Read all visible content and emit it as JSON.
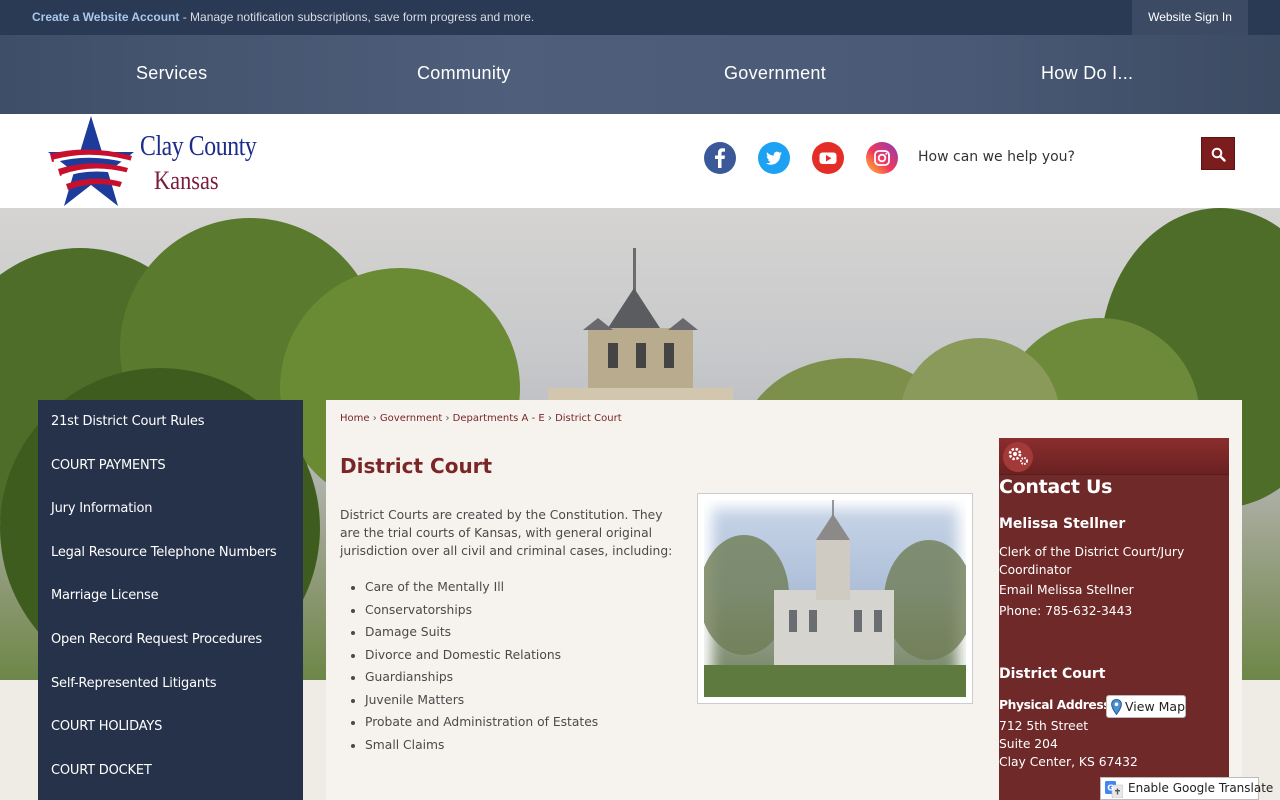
{
  "topbar": {
    "create_account_link": "Create a Website Account",
    "message": " - Manage notification subscriptions, save form progress and more.",
    "sign_in": "Website Sign In"
  },
  "main_nav": {
    "items": [
      "Services",
      "Community",
      "Government",
      "How Do I..."
    ]
  },
  "header": {
    "logo_line1": "Clay County",
    "logo_line2": "Kansas",
    "social_icons": [
      "facebook-icon",
      "twitter-icon",
      "youtube-icon",
      "instagram-icon"
    ],
    "search_placeholder": "How can we help you?",
    "search_icon": "search-icon"
  },
  "sidebar": {
    "items": [
      "21st District Court Rules",
      "COURT PAYMENTS",
      "Jury Information",
      "Legal Resource Telephone Numbers",
      "Marriage License",
      "Open Record Request Procedures",
      "Self-Represented Litigants",
      "COURT HOLIDAYS",
      "COURT DOCKET"
    ]
  },
  "breadcrumb": {
    "items": [
      "Home",
      "Government",
      "Departments A - E",
      "District Court"
    ],
    "separator": "›"
  },
  "main": {
    "title": "District Court",
    "intro": "District Courts are created by the Constitution. They are the trial courts of Kansas, with general original jurisdiction over all civil and criminal cases, including:",
    "cases": [
      "Care of the Mentally Ill",
      "Conservatorships",
      "Damage Suits",
      "Divorce and Domestic Relations",
      "Guardianships",
      "Juvenile Matters",
      "Probate and Administration of Estates",
      "Small Claims"
    ]
  },
  "contact": {
    "title": "Contact Us",
    "name": "Melissa Stellner",
    "role": "Clerk of the District Court/Jury Coordinator",
    "email": "Email Melissa Stellner",
    "phone": "Phone: 785-632-3443",
    "department": "District Court",
    "address_label": "Physical Address",
    "map_button": "View Map",
    "address_lines": [
      "712 5th Street",
      "Suite 204",
      "Clay Center, KS 67432"
    ]
  },
  "translate": {
    "label": "Enable Google Translate"
  },
  "colors": {
    "topbar": "#2a3954",
    "accent_red": "#7a2626",
    "sidebar": "#26324a",
    "contact_panel": "#6f2929"
  }
}
